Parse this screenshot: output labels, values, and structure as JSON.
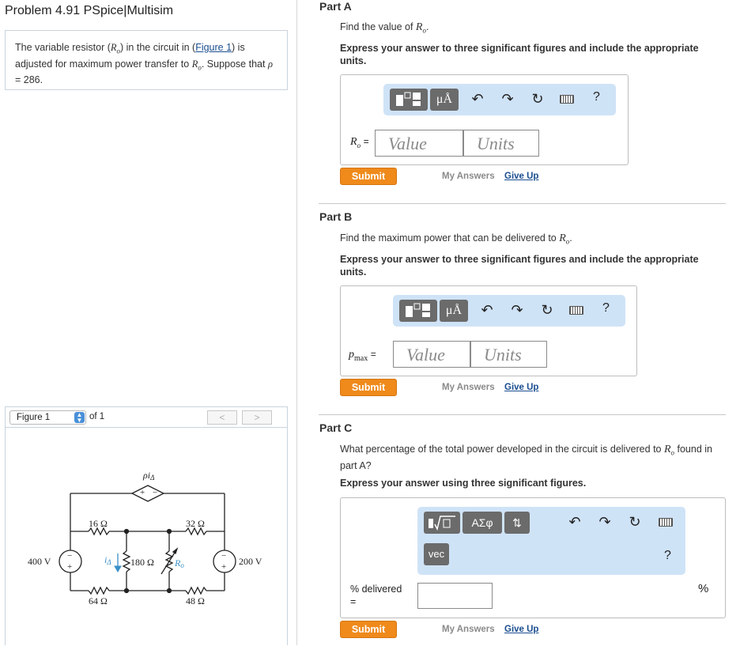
{
  "problem": {
    "title": "Problem 4.91 PSpice|Multisim",
    "text_pre": "The variable resistor (",
    "var": "R",
    "sub": "o",
    "text_mid": ") in the circuit in (",
    "figure_link": "Figure 1",
    "text_post": ") is adjusted for maximum power transfer to ",
    "text_post2": ". Suppose that ",
    "rho_var": "ρ",
    "rho_value": " = 286."
  },
  "figure": {
    "selector": "Figure 1",
    "of_label": "of 1",
    "prev": "<",
    "next": ">",
    "circuit_labels": {
      "dep_source": "ρi",
      "dep_sub": "Δ",
      "plus": "+",
      "minus": "−",
      "r16": "16 Ω",
      "r32": "32 Ω",
      "r64": "64 Ω",
      "r48": "48 Ω",
      "r180": "180 Ω",
      "rvar": "R",
      "rvar_sub": "o",
      "v400": "400 V",
      "v200": "200 V",
      "ia": "i",
      "ia_sub": "Δ"
    }
  },
  "parts": [
    {
      "head": "Part A",
      "prompt_pre": "Find the value of ",
      "prompt_var": "R",
      "prompt_sub": "o",
      "prompt_post": ".",
      "instruction": "Express your answer to three significant figures and include the appropriate units.",
      "label_var": "R",
      "label_sub": "o",
      "label_eq": "=",
      "value_placeholder": "Value",
      "units_placeholder": "Units",
      "unit_btn": "μÅ",
      "help": "?",
      "submit": "Submit",
      "my_answers": "My Answers",
      "give_up": "Give Up"
    },
    {
      "head": "Part B",
      "prompt_pre": "Find the maximum power that can be delivered to ",
      "prompt_var": "R",
      "prompt_sub": "o",
      "prompt_post": ".",
      "instruction": "Express your answer to three significant figures and include the appropriate units.",
      "label_var": "p",
      "label_sub": "max",
      "label_eq": "=",
      "value_placeholder": "Value",
      "units_placeholder": "Units",
      "unit_btn": "μÅ",
      "help": "?",
      "submit": "Submit",
      "my_answers": "My Answers",
      "give_up": "Give Up"
    },
    {
      "head": "Part C",
      "prompt_pre": "What percentage of the total power developed in the circuit is delivered to ",
      "prompt_var": "R",
      "prompt_sub": "o",
      "prompt_post": " found in part A?",
      "instruction": "Express your answer using three significant figures.",
      "label": "% delivered",
      "label_eq": "=",
      "unit_suffix": "%",
      "greek_btn": "ΑΣφ",
      "vec_btn": "vec",
      "help": "?",
      "submit": "Submit",
      "my_answers": "My Answers",
      "give_up": "Give Up"
    }
  ],
  "colors": {
    "accent_orange": "#ef8a1b",
    "toolbar_blue": "#cfe3f7",
    "link_blue": "#1a4d8f",
    "circuit_blue": "#3a8fc7"
  },
  "icons": [
    "templates-icon",
    "undo-icon",
    "redo-icon",
    "reset-icon",
    "keyboard-icon",
    "help-icon",
    "sqrt-icon",
    "updown-icon"
  ]
}
